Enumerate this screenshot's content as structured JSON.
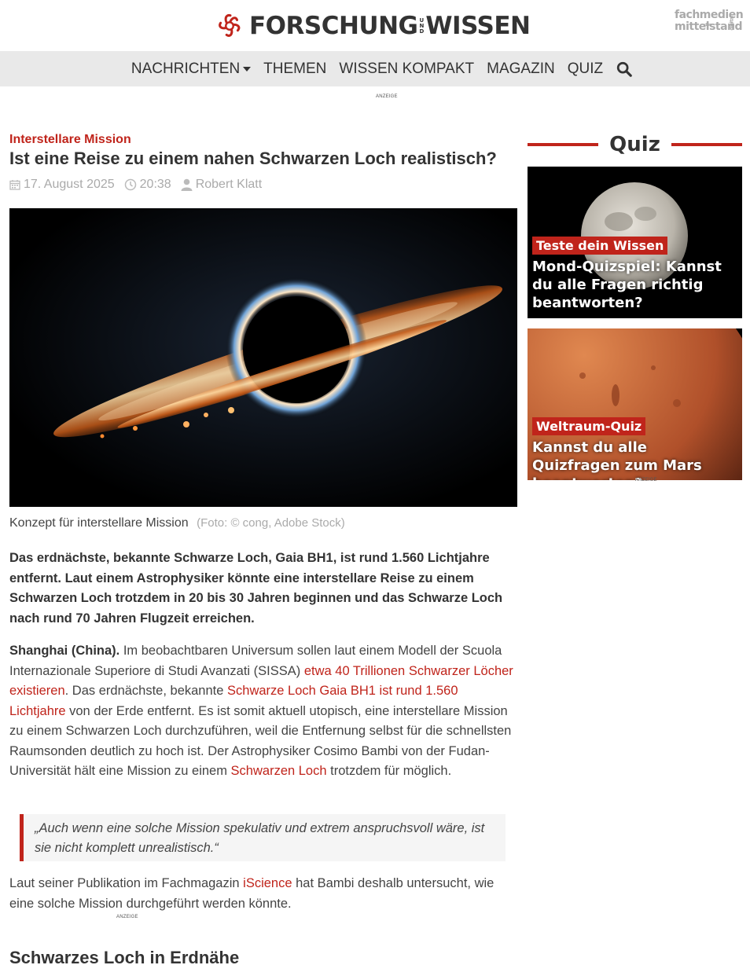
{
  "header": {
    "logo_left": "FORSCHUNG",
    "logo_und_1": "U",
    "logo_und_2": "N",
    "logo_und_3": "D",
    "logo_right": "WISSEN",
    "partner_line1": "fachmedien",
    "partner_line2": "mittelstand",
    "partner_small": "digital",
    "partner_tiny": "der"
  },
  "nav": {
    "items": [
      {
        "label": "NACHRICHTEN",
        "has_dropdown": true
      },
      {
        "label": "THEMEN"
      },
      {
        "label": "WISSEN KOMPAKT"
      },
      {
        "label": "MAGAZIN"
      },
      {
        "label": "QUIZ"
      }
    ],
    "search_icon": "search-icon"
  },
  "ads": {
    "label": "ANZEIGE"
  },
  "article": {
    "kicker": "Interstellare Mission",
    "title": "Ist eine Reise zu einem nahen Schwarzen Loch realistisch?",
    "date": "17. August 2025",
    "time": "20:38",
    "author": "Robert Klatt",
    "image_caption": "Konzept für interstellare Mission",
    "image_credit": "(Foto: © cong, Adobe Stock)",
    "lead": "Das erdnächste, bekannte Schwarze Loch, Gaia BH1, ist rund 1.560 Lichtjahre entfernt. Laut einem Astrophysiker könnte eine interstellare Reise zu einem Schwarzen Loch trotzdem in 20 bis 30 Jahren beginnen und das Schwarze Loch nach rund 70 Jahren Flugzeit erreichen.",
    "body": {
      "dateline": "Shanghai (China).",
      "t1": " Im beobachtbaren Universum sollen laut einem Modell der Scuola Internazionale Superiore di Studi Avanzati (SISSA) ",
      "link1": "etwa 40 Trillionen Schwarzer Löcher existieren",
      "t2": ". Das erdnächste, bekannte ",
      "link2": "Schwarze Loch Gaia BH1 ist rund 1.560 Lichtjahre",
      "t3": " von der Erde entfernt. Es ist somit aktuell utopisch, eine interstellare Mission zu einem Schwarzen Loch durchzuführen, weil die Entfernung selbst für die schnellsten Raumsonden deutlich zu hoch ist. Der Astrophysiker Cosimo Bambi von der Fudan-Universität hält eine Mission zu einem ",
      "link3": "Schwarzen Loch",
      "t4": " trotzdem für möglich."
    },
    "quote": "„Auch wenn eine solche Mission spekulativ und extrem anspruchsvoll wäre, ist sie nicht komplett unrealistisch.“",
    "para2": {
      "t1": "Laut seiner Publikation im Fachmagazin ",
      "link": "iScience",
      "t2": " hat Bambi deshalb untersucht, wie eine solche Mission durchgeführt werden könnte."
    },
    "subheading": "Schwarzes Loch in Erdnähe"
  },
  "sidebar": {
    "section_title": "Quiz",
    "cards": [
      {
        "tag": "Teste dein Wissen",
        "title": "Mond-Quizspiel: Kannst du alle Fragen richtig beantworten?"
      },
      {
        "tag": "Weltraum-Quiz",
        "title": "Kannst du alle Quizfragen zum Mars beantworten?"
      }
    ]
  },
  "colors": {
    "accent": "#c0241b",
    "nav_bg": "#e9e9e9",
    "text": "#333333",
    "muted": "#aaaaaa"
  }
}
